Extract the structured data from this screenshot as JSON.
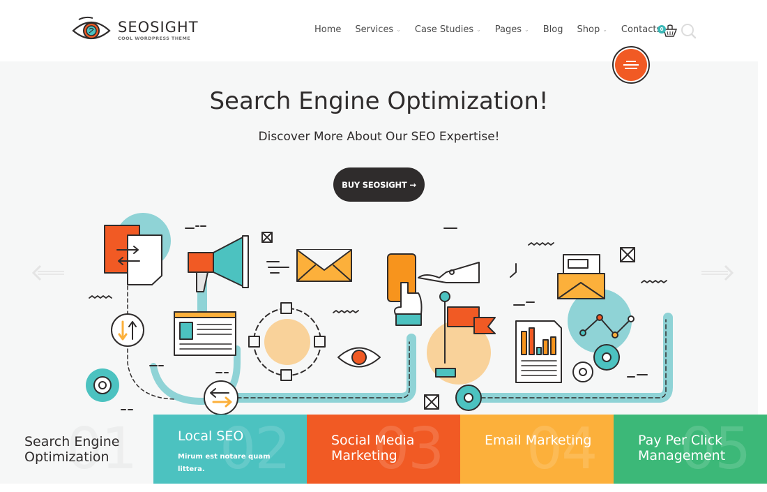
{
  "header": {
    "logo": {
      "title": "SEOSIGHT",
      "subtitle": "COOL WORDPRESS THEME",
      "icon": "eye-logo-icon"
    },
    "nav": [
      {
        "label": "Home",
        "has_dropdown": false
      },
      {
        "label": "Services",
        "has_dropdown": true
      },
      {
        "label": "Case Studies",
        "has_dropdown": true
      },
      {
        "label": "Pages",
        "has_dropdown": true
      },
      {
        "label": "Blog",
        "has_dropdown": false
      },
      {
        "label": "Shop",
        "has_dropdown": true
      },
      {
        "label": "Contacts",
        "has_dropdown": false
      }
    ],
    "dropdown_caret": "⌄",
    "cart": {
      "icon": "basket-icon",
      "count": "0"
    },
    "search": {
      "icon": "search-icon"
    },
    "menu_button": {
      "icon": "hamburger-icon"
    }
  },
  "hero": {
    "title": "Search Engine Optimization!",
    "subtitle": "Discover More About Our SEO Expertise!",
    "cta_label": "BUY SEOSIGHT →",
    "prev_arrow": "arrow-left-icon",
    "next_arrow": "arrow-right-icon"
  },
  "services": [
    {
      "number": "01",
      "title": "Search Engine Optimization",
      "description": "",
      "color": "#f6f7f7"
    },
    {
      "number": "02",
      "title": "Local SEO",
      "description": "Mirum est notare quam littera.",
      "color": "#4cc2c0"
    },
    {
      "number": "03",
      "title": "Social Media Marketing",
      "description": "",
      "color": "#f15a24"
    },
    {
      "number": "04",
      "title": "Email Marketing",
      "description": "",
      "color": "#fcb03b"
    },
    {
      "number": "05",
      "title": "Pay Per Click Management",
      "description": "",
      "color": "#3cb878"
    }
  ],
  "colors": {
    "dark": "#2f2c2c",
    "orange": "#f15a24",
    "teal": "#4cc2c0",
    "light_teal": "#8fd3d6",
    "yellow": "#fcb03b",
    "peach": "#f9d29a",
    "green": "#3cb878",
    "hero_bg": "#f6f7f7"
  }
}
